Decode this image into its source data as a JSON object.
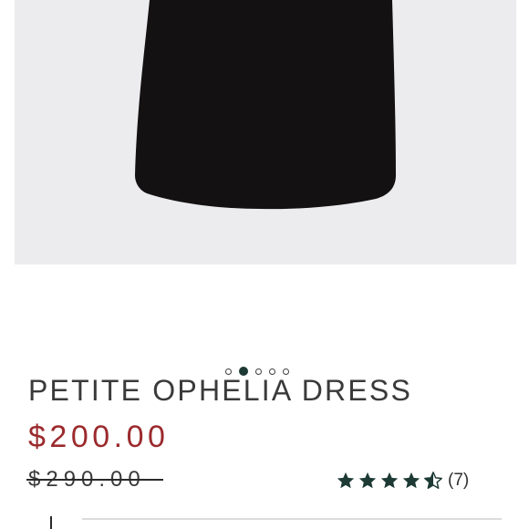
{
  "product": {
    "image_alt": "Black dress product photo",
    "title": "PETITE OPHELIA DRESS",
    "price": "$200.00",
    "original_price": "$290.00"
  },
  "carousel": {
    "dot_count": 5,
    "active_index": 1
  },
  "rating": {
    "value": 4.5,
    "max": 5,
    "count_label": "(7)",
    "star_color": "#1d3a34"
  },
  "colors": {
    "price": "#9b2a2d",
    "image_background": "#ececee",
    "dress": "#141112"
  }
}
